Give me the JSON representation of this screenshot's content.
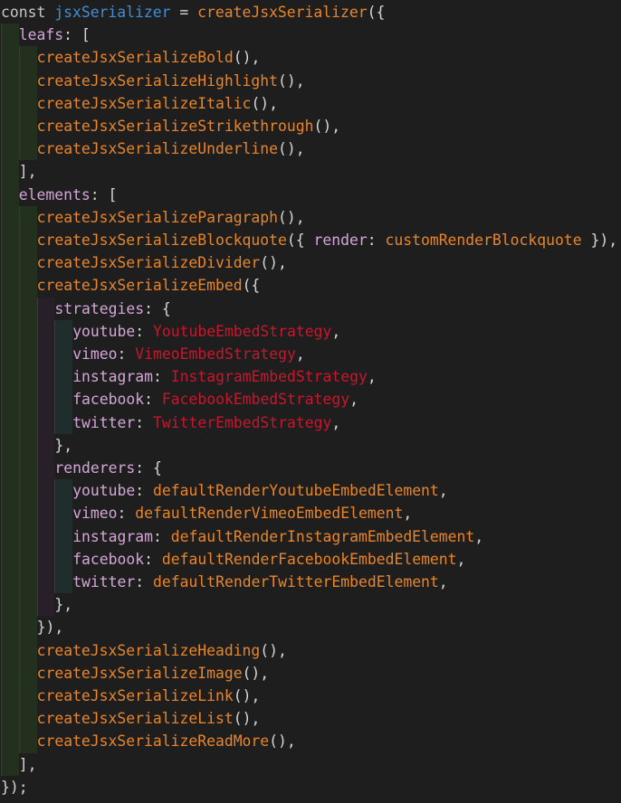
{
  "editor": {
    "colors": {
      "background": "#1e1e1e",
      "keyword": "#c7c7c7",
      "variable": "#3f8fd8",
      "function": "#e8852b",
      "punctuation": "#d6d6d6",
      "property": "#d4a5d8",
      "class": "#c7172d",
      "guide_level1": "#24301e",
      "guide_level2": "#282028",
      "guide_level3": "#1f2d2d"
    },
    "lines": [
      {
        "indent": 0,
        "tokens": [
          {
            "t": "const ",
            "c": "keyword"
          },
          {
            "t": "jsxSerializer",
            "c": "variable"
          },
          {
            "t": " = ",
            "c": "punct"
          },
          {
            "t": "createJsxSerializer",
            "c": "func"
          },
          {
            "t": "({",
            "c": "punct"
          }
        ]
      },
      {
        "indent": 1,
        "tokens": [
          {
            "t": "leafs",
            "c": "prop"
          },
          {
            "t": ": [",
            "c": "punct"
          }
        ]
      },
      {
        "indent": 2,
        "tokens": [
          {
            "t": "createJsxSerializeBold",
            "c": "func"
          },
          {
            "t": "(),",
            "c": "punct"
          }
        ]
      },
      {
        "indent": 2,
        "tokens": [
          {
            "t": "createJsxSerializeHighlight",
            "c": "func"
          },
          {
            "t": "(),",
            "c": "punct"
          }
        ]
      },
      {
        "indent": 2,
        "tokens": [
          {
            "t": "createJsxSerializeItalic",
            "c": "func"
          },
          {
            "t": "(),",
            "c": "punct"
          }
        ]
      },
      {
        "indent": 2,
        "tokens": [
          {
            "t": "createJsxSerializeStrikethrough",
            "c": "func"
          },
          {
            "t": "(),",
            "c": "punct"
          }
        ]
      },
      {
        "indent": 2,
        "tokens": [
          {
            "t": "createJsxSerializeUnderline",
            "c": "func"
          },
          {
            "t": "(),",
            "c": "punct"
          }
        ]
      },
      {
        "indent": 1,
        "tokens": [
          {
            "t": "],",
            "c": "punct"
          }
        ]
      },
      {
        "indent": 1,
        "tokens": [
          {
            "t": "elements",
            "c": "prop"
          },
          {
            "t": ": [",
            "c": "punct"
          }
        ]
      },
      {
        "indent": 2,
        "tokens": [
          {
            "t": "createJsxSerializeParagraph",
            "c": "func"
          },
          {
            "t": "(),",
            "c": "punct"
          }
        ]
      },
      {
        "indent": 2,
        "tokens": [
          {
            "t": "createJsxSerializeBlockquote",
            "c": "func"
          },
          {
            "t": "({ ",
            "c": "punct"
          },
          {
            "t": "render",
            "c": "prop"
          },
          {
            "t": ": ",
            "c": "punct"
          },
          {
            "t": "customRenderBlockquote",
            "c": "renderVal"
          },
          {
            "t": " }),",
            "c": "punct"
          }
        ]
      },
      {
        "indent": 2,
        "tokens": [
          {
            "t": "createJsxSerializeDivider",
            "c": "func"
          },
          {
            "t": "(),",
            "c": "punct"
          }
        ]
      },
      {
        "indent": 2,
        "tokens": [
          {
            "t": "createJsxSerializeEmbed",
            "c": "func"
          },
          {
            "t": "({",
            "c": "punct"
          }
        ]
      },
      {
        "indent": 3,
        "tokens": [
          {
            "t": "strategies",
            "c": "prop"
          },
          {
            "t": ": {",
            "c": "punct"
          }
        ]
      },
      {
        "indent": 4,
        "tokens": [
          {
            "t": "youtube",
            "c": "prop"
          },
          {
            "t": ": ",
            "c": "punct"
          },
          {
            "t": "YoutubeEmbedStrategy",
            "c": "class"
          },
          {
            "t": ",",
            "c": "punct"
          }
        ]
      },
      {
        "indent": 4,
        "tokens": [
          {
            "t": "vimeo",
            "c": "prop"
          },
          {
            "t": ": ",
            "c": "punct"
          },
          {
            "t": "VimeoEmbedStrategy",
            "c": "class"
          },
          {
            "t": ",",
            "c": "punct"
          }
        ]
      },
      {
        "indent": 4,
        "tokens": [
          {
            "t": "instagram",
            "c": "prop"
          },
          {
            "t": ": ",
            "c": "punct"
          },
          {
            "t": "InstagramEmbedStrategy",
            "c": "class"
          },
          {
            "t": ",",
            "c": "punct"
          }
        ]
      },
      {
        "indent": 4,
        "tokens": [
          {
            "t": "facebook",
            "c": "prop"
          },
          {
            "t": ": ",
            "c": "punct"
          },
          {
            "t": "FacebookEmbedStrategy",
            "c": "class"
          },
          {
            "t": ",",
            "c": "punct"
          }
        ]
      },
      {
        "indent": 4,
        "tokens": [
          {
            "t": "twitter",
            "c": "prop"
          },
          {
            "t": ": ",
            "c": "punct"
          },
          {
            "t": "TwitterEmbedStrategy",
            "c": "class"
          },
          {
            "t": ",",
            "c": "punct"
          }
        ]
      },
      {
        "indent": 3,
        "tokens": [
          {
            "t": "},",
            "c": "punct"
          }
        ]
      },
      {
        "indent": 3,
        "tokens": [
          {
            "t": "renderers",
            "c": "prop"
          },
          {
            "t": ": {",
            "c": "punct"
          }
        ]
      },
      {
        "indent": 4,
        "tokens": [
          {
            "t": "youtube",
            "c": "prop"
          },
          {
            "t": ": ",
            "c": "punct"
          },
          {
            "t": "defaultRenderYoutubeEmbedElement",
            "c": "renderVal"
          },
          {
            "t": ",",
            "c": "punct"
          }
        ]
      },
      {
        "indent": 4,
        "tokens": [
          {
            "t": "vimeo",
            "c": "prop"
          },
          {
            "t": ": ",
            "c": "punct"
          },
          {
            "t": "defaultRenderVimeoEmbedElement",
            "c": "renderVal"
          },
          {
            "t": ",",
            "c": "punct"
          }
        ]
      },
      {
        "indent": 4,
        "tokens": [
          {
            "t": "instagram",
            "c": "prop"
          },
          {
            "t": ": ",
            "c": "punct"
          },
          {
            "t": "defaultRenderInstagramEmbedElement",
            "c": "renderVal"
          },
          {
            "t": ",",
            "c": "punct"
          }
        ]
      },
      {
        "indent": 4,
        "tokens": [
          {
            "t": "facebook",
            "c": "prop"
          },
          {
            "t": ": ",
            "c": "punct"
          },
          {
            "t": "defaultRenderFacebookEmbedElement",
            "c": "renderVal"
          },
          {
            "t": ",",
            "c": "punct"
          }
        ]
      },
      {
        "indent": 4,
        "tokens": [
          {
            "t": "twitter",
            "c": "prop"
          },
          {
            "t": ": ",
            "c": "punct"
          },
          {
            "t": "defaultRenderTwitterEmbedElement",
            "c": "renderVal"
          },
          {
            "t": ",",
            "c": "punct"
          }
        ]
      },
      {
        "indent": 3,
        "tokens": [
          {
            "t": "},",
            "c": "punct"
          }
        ]
      },
      {
        "indent": 2,
        "tokens": [
          {
            "t": "}),",
            "c": "punct"
          }
        ]
      },
      {
        "indent": 2,
        "tokens": [
          {
            "t": "createJsxSerializeHeading",
            "c": "func"
          },
          {
            "t": "(),",
            "c": "punct"
          }
        ]
      },
      {
        "indent": 2,
        "tokens": [
          {
            "t": "createJsxSerializeImage",
            "c": "func"
          },
          {
            "t": "(),",
            "c": "punct"
          }
        ]
      },
      {
        "indent": 2,
        "tokens": [
          {
            "t": "createJsxSerializeLink",
            "c": "func"
          },
          {
            "t": "(),",
            "c": "punct"
          }
        ]
      },
      {
        "indent": 2,
        "tokens": [
          {
            "t": "createJsxSerializeList",
            "c": "func"
          },
          {
            "t": "(),",
            "c": "punct"
          }
        ]
      },
      {
        "indent": 2,
        "tokens": [
          {
            "t": "createJsxSerializeReadMore",
            "c": "func"
          },
          {
            "t": "(),",
            "c": "punct"
          }
        ]
      },
      {
        "indent": 1,
        "tokens": [
          {
            "t": "],",
            "c": "punct"
          }
        ]
      },
      {
        "indent": 0,
        "tokens": [
          {
            "t": "});",
            "c": "punct"
          }
        ]
      }
    ]
  }
}
